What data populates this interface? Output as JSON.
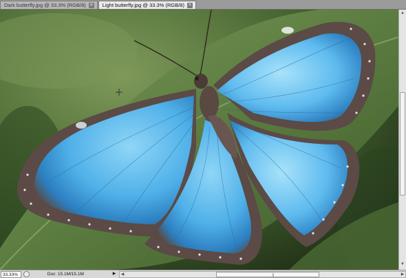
{
  "tabs": [
    {
      "label": "Dark butterfly.jpg @ 33.3% (RGB/8)",
      "active": false
    },
    {
      "label": "Light butterfly.jpg @ 33.3% (RGB/8)",
      "active": true
    }
  ],
  "tab_close_glyph": "×",
  "canvas": {
    "image_subject": "butterfly-photo",
    "colors": {
      "leaf_dark": "#2f4a22",
      "leaf_light": "#6d8a4c",
      "wing_blue": "#5fb6ea",
      "wing_edge": "#5a4a44"
    }
  },
  "status": {
    "zoom": "33.33%",
    "doc": "Doc: 15.1M/15.1M",
    "arrow_glyph": "▶"
  },
  "scroll": {
    "up_glyph": "▲",
    "down_glyph": "▼",
    "left_glyph": "◀",
    "right_glyph": "▶"
  }
}
